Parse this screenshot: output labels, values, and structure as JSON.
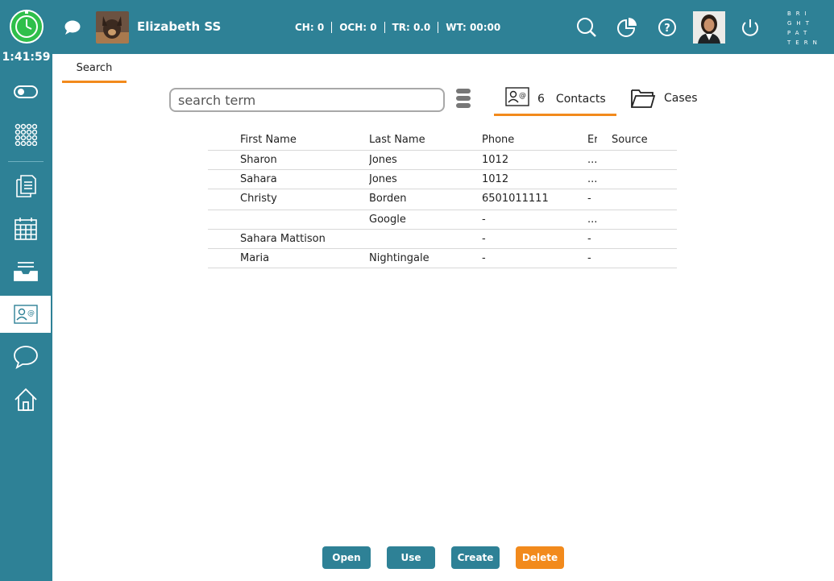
{
  "header": {
    "agent_name": "Elizabeth SS",
    "stats": [
      "CH: 0",
      "OCH: 0",
      "TR: 0.0",
      "WT: 00:00"
    ],
    "brand_lines": [
      "BRI",
      "GHT",
      "PAT",
      "TERN"
    ]
  },
  "sidebar": {
    "timer": "1:41:59"
  },
  "tabs": {
    "search": "Search"
  },
  "search": {
    "placeholder": "search term"
  },
  "results": {
    "contacts_count": "6",
    "contacts_label": "Contacts",
    "cases_label": "Cases"
  },
  "table": {
    "headers": [
      "First Name",
      "Last Name",
      "Phone",
      "Er",
      "Source"
    ],
    "rows": [
      [
        "Sharon",
        "Jones",
        "1012",
        "...",
        ""
      ],
      [
        "Sahara",
        "Jones",
        "1012",
        "...",
        ""
      ],
      [
        "Christy",
        "Borden",
        "6501011111",
        "-",
        ""
      ],
      [
        "",
        "Google",
        "-",
        "...",
        ""
      ],
      [
        "Sahara Mattison",
        "",
        "-",
        "-",
        ""
      ],
      [
        "Maria",
        "Nightingale",
        "-",
        "-",
        ""
      ]
    ]
  },
  "buttons": {
    "open": "Open",
    "use": "Use",
    "create": "Create",
    "delete": "Delete"
  },
  "colors": {
    "primary": "#2e8196",
    "accent": "#f28a1c",
    "clock": "#2fbf4a"
  }
}
